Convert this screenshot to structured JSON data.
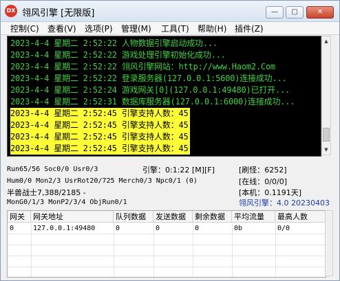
{
  "window": {
    "title": "翎风引擎 [无限版]",
    "app_icon_text": "DX",
    "minimize": "—",
    "maximize": "□",
    "close": "✕"
  },
  "menu": [
    "控制(C)",
    "查看(V)",
    "选项(P)",
    "管理(M)",
    "工具(T)",
    "帮助(H)",
    "插件(Z)"
  ],
  "log": [
    {
      "text": "2023-4-4 星期二 2:52:22 人物数据引擎启动成功...",
      "style": "green"
    },
    {
      "text": "2023-4-4 星期二 2:52:22 游戏处理引擎初始化成功...",
      "style": "green"
    },
    {
      "text": "2023-4-4 星期二 2:52:22 翎风引擎网站：http://www.Haom2.Com",
      "style": "green"
    },
    {
      "text": "2023-4-4 星期二 2:52:22 登录服务器(127.0.0.1:5600)连接成功...",
      "style": "green"
    },
    {
      "text": "2023-4-4 星期二 2:52:24 游戏网关[0](127.0.0.1:49480)已打开...",
      "style": "green"
    },
    {
      "text": "2023-4-4 星期二 2:52:31 数据库服务器(127.0.0.1:6000)连接成功...",
      "style": "green"
    },
    {
      "text": "2023-4-4 星期二 2:52:45 引擎支持人数：45",
      "style": "hl"
    },
    {
      "text": "2023-4-4 星期二 2:52:45 引擎支持人数：45",
      "style": "hl"
    },
    {
      "text": "2023-4-4 星期二 2:52:45 引擎支持人数：45",
      "style": "hl"
    },
    {
      "text": "2023-4-4 星期二 2:52:45 引擎支持人数：45",
      "style": "hl"
    }
  ],
  "status": {
    "run": "Run65/56 Soc0/0 Usr0/3",
    "engine_time": "引擎：0:1:22 [M][F]",
    "refresh": "[刷怪：6252]",
    "hum": "Hum0/0 Mon2/3 UsrRot20/725 Merch0/3 Npc0/1 (0)",
    "online": "[在线：0/0/0]",
    "npc_info": "半兽战士7,388/2185 -",
    "local": "[本机：0.1191天]",
    "mongo": "MonG0/1/3 MonP2/3/4 ObjRun0/1",
    "version": "翎风引擎：4.0 20230403"
  },
  "table": {
    "headers": [
      "网关",
      "网关地址",
      "队列数据",
      "发送数据",
      "剩余数据",
      "平均流量",
      "最高人数"
    ],
    "rows": [
      [
        "0",
        "127.0.0.1:49480",
        "0",
        "0",
        "0",
        "0b",
        "0/0"
      ]
    ]
  },
  "colors": {
    "console_bg": "#000000",
    "log_green": "#3fd23f",
    "highlight": "#ffff38",
    "version_blue": "#1a3aa8"
  }
}
